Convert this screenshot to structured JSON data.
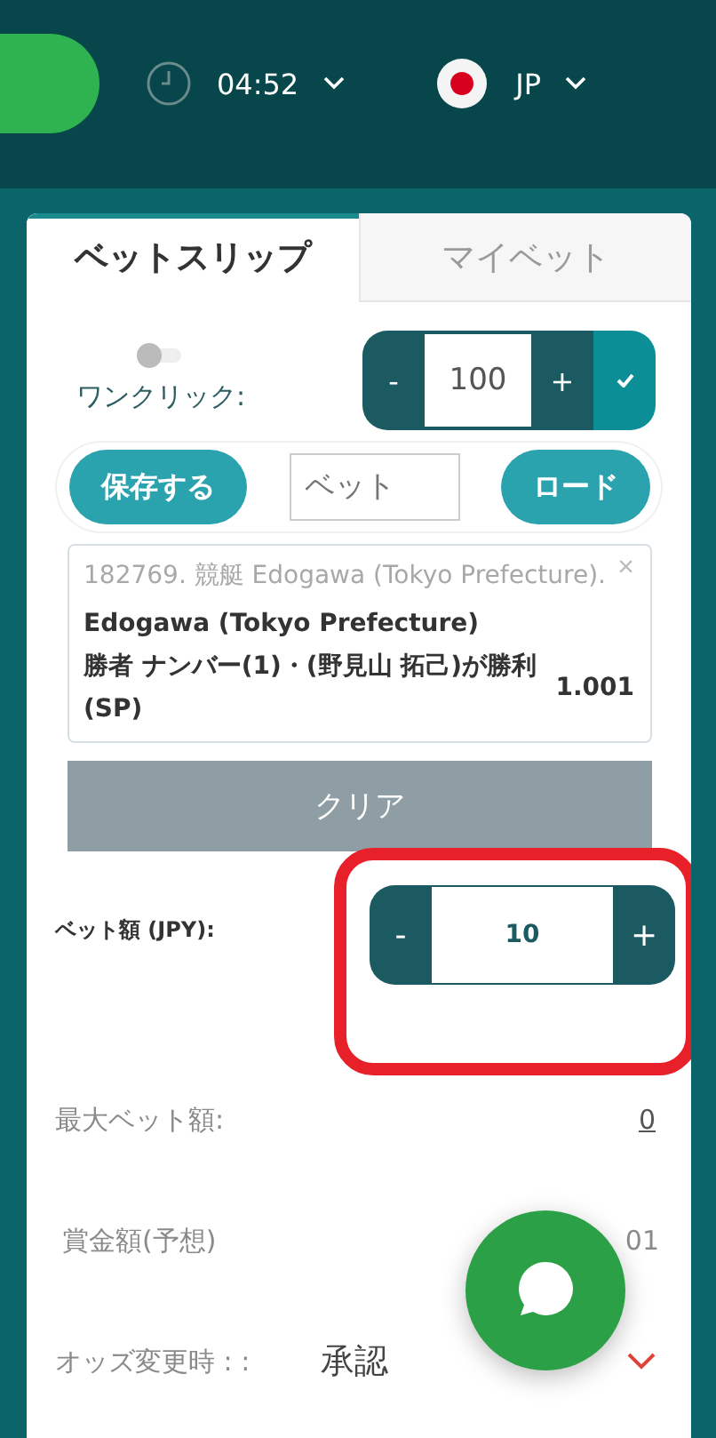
{
  "header": {
    "time": "04:52",
    "language": "JP"
  },
  "tabs": [
    {
      "label": "ベットスリップ",
      "selected": true
    },
    {
      "label": "マイベット",
      "selected": false
    }
  ],
  "one_click": {
    "label": "ワンクリック:",
    "on": false
  },
  "quick_stake": {
    "minus": "-",
    "value": "100",
    "plus": "+"
  },
  "save_button": "保存する",
  "name_field": {
    "placeholder": "ベット"
  },
  "load_button": "ロード",
  "selection": {
    "event": "182769. 競艇 Edogawa (Tokyo Prefecture).",
    "close": "×",
    "market": "Edogawa (Tokyo Prefecture)",
    "outcome": "勝者 ナンバー(1)・(野見山 拓己)が勝利(SP)",
    "odds": "1.001"
  },
  "clear_button": "クリア",
  "stake": {
    "label": "ベット額 (JPY):",
    "minus": "-",
    "value": "10",
    "plus": "+",
    "highlighted": true
  },
  "max_stake": {
    "label": "最大ベット額:",
    "value": "0"
  },
  "potential_win": {
    "label": "賞金額(予想)",
    "value": "01"
  },
  "odds_change": {
    "label": "オッズ変更時 : :",
    "value": "承認"
  }
}
